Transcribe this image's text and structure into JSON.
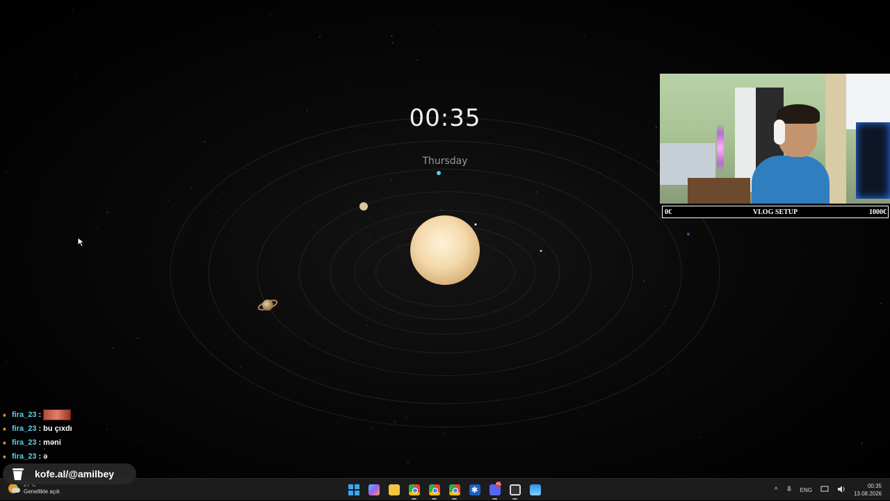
{
  "wallpaper": {
    "clock": "00:35",
    "weekday": "Thursday"
  },
  "webcam": {
    "description_icon": "webcam-feed",
    "goal": {
      "start": "0€",
      "title": "VLOG SETUP",
      "end": "1000€",
      "progress": 0
    }
  },
  "chat": {
    "messages": [
      {
        "user": "fira_23",
        "sep": ":",
        "text": "",
        "emote": "emote-image"
      },
      {
        "user": "fira_23",
        "sep": ":",
        "text": "bu çıxdı"
      },
      {
        "user": "fira_23",
        "sep": ":",
        "text": "məni"
      },
      {
        "user": "fira_23",
        "sep": ":",
        "text": "ə"
      }
    ]
  },
  "donation": {
    "label": "kofe.al/@amilbey",
    "icon": "coffee-cup-icon"
  },
  "taskbar": {
    "weather": {
      "temp": "27°C",
      "condition": "Genellikle açık"
    },
    "apps": [
      {
        "name": "start",
        "icon": "windows-start-icon"
      },
      {
        "name": "copilot",
        "icon": "copilot-icon"
      },
      {
        "name": "file-explorer",
        "icon": "folder-icon"
      },
      {
        "name": "chrome-1",
        "icon": "chrome-icon"
      },
      {
        "name": "chrome-2",
        "icon": "chrome-icon"
      },
      {
        "name": "chrome-3",
        "icon": "chrome-icon"
      },
      {
        "name": "app-snow",
        "icon": "snowflake-icon"
      },
      {
        "name": "discord",
        "icon": "discord-icon",
        "badge": "41"
      },
      {
        "name": "obs",
        "icon": "obs-icon"
      },
      {
        "name": "photos",
        "icon": "photos-icon"
      }
    ],
    "tray": {
      "chevron": "^",
      "language": "ENG",
      "time": "00:35",
      "date": "13.08.2026"
    }
  }
}
